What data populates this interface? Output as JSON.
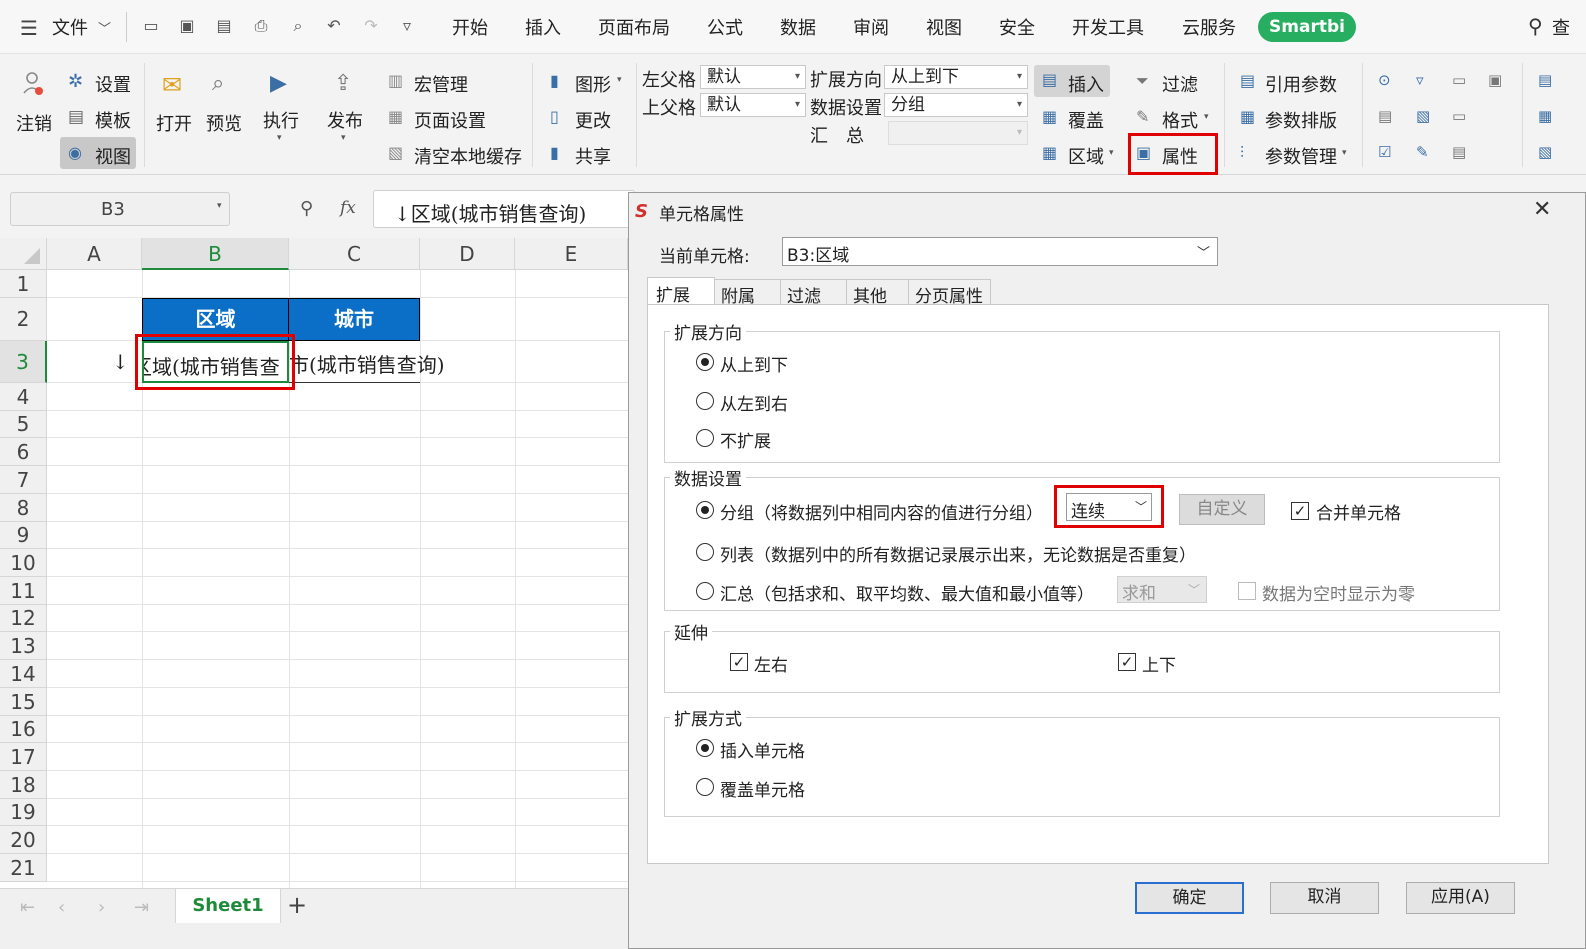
{
  "menubar": {
    "file": "文件",
    "tabs": [
      "开始",
      "插入",
      "页面布局",
      "公式",
      "数据",
      "审阅",
      "视图",
      "安全",
      "开发工具",
      "云服务"
    ],
    "smartbi": "Smartbi",
    "search": "查"
  },
  "ribbon": {
    "logout": "注销",
    "settings": "设置",
    "template": "模板",
    "view": "视图",
    "open": "打开",
    "preview": "预览",
    "execute": "执行",
    "publish": "发布",
    "macro": "宏管理",
    "page_setup": "页面设置",
    "clear_cache": "清空本地缓存",
    "chart": "图形",
    "modify": "更改",
    "share": "共享",
    "left_parent_label": "左父格",
    "left_parent_value": "默认",
    "top_parent_label": "上父格",
    "top_parent_value": "默认",
    "expand_dir_label": "扩展方向",
    "expand_dir_value": "从上到下",
    "data_setting_label": "数据设置",
    "data_setting_value": "分组",
    "summary_label": "汇　总",
    "insert": "插入",
    "cover": "覆盖",
    "region": "区域",
    "filter": "过滤",
    "format": "格式",
    "property": "属性",
    "ref_param": "引用参数",
    "param_layout": "参数排版",
    "param_mgmt": "参数管理"
  },
  "formula": {
    "cell_ref": "B3",
    "fx": "fx",
    "content": "↓区域(城市销售查询)"
  },
  "grid": {
    "columns": [
      "A",
      "B",
      "C",
      "D",
      "E"
    ],
    "rows": [
      "1",
      "2",
      "3",
      "4",
      "5",
      "6",
      "7",
      "8",
      "9",
      "10",
      "11",
      "12",
      "13",
      "14",
      "15",
      "16",
      "17",
      "18",
      "19",
      "20",
      "21"
    ],
    "b2": "区域",
    "c2": "城市",
    "a3": "↓",
    "b3": "区域(城市销售查",
    "c3": "市(城市销售查询)"
  },
  "sheets": {
    "active": "Sheet1",
    "add": "+"
  },
  "dialog": {
    "title": "单元格属性",
    "current_cell_label": "当前单元格:",
    "current_cell_value": "B3:区域",
    "tabs": [
      "扩展",
      "附属",
      "过滤",
      "其他",
      "分页属性"
    ],
    "expand_dir": {
      "legend": "扩展方向",
      "options": [
        "从上到下",
        "从左到右",
        "不扩展"
      ],
      "selected": 0
    },
    "data_setting": {
      "legend": "数据设置",
      "group": "分组（将数据列中相同内容的值进行分组）",
      "group_mode": "连续",
      "custom_btn": "自定义",
      "merge_cells": "合并单元格",
      "merge_checked": true,
      "list": "列表（数据列中的所有数据记录展示出来，无论数据是否重复）",
      "summary": "汇总（包括求和、取平均数、最大值和最小值等）",
      "summary_func": "求和",
      "empty_zero": "数据为空时显示为零",
      "empty_zero_checked": false
    },
    "extend": {
      "legend": "延伸",
      "left_right": "左右",
      "top_bottom": "上下"
    },
    "expand_mode": {
      "legend": "扩展方式",
      "options": [
        "插入单元格",
        "覆盖单元格"
      ],
      "selected": 0
    },
    "ok": "确定",
    "cancel": "取消",
    "apply": "应用(A)"
  }
}
